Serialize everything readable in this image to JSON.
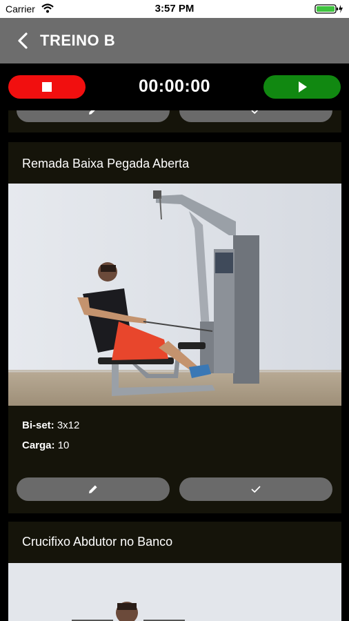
{
  "status_bar": {
    "carrier": "Carrier",
    "time": "3:57 PM"
  },
  "nav": {
    "title": "TREINO B",
    "back_icon": "chevron-left-icon"
  },
  "timer": {
    "value": "00:00:00",
    "stop_icon": "stop-icon",
    "play_icon": "play-icon"
  },
  "exercises": [
    {
      "title": "Remada Baixa Pegada Aberta",
      "set_label": "Bi-set:",
      "set_value": "3x12",
      "load_label": "Carga:",
      "load_value": "10",
      "edit_icon": "pencil-icon",
      "done_icon": "check-icon"
    },
    {
      "title": "Crucifixo Abdutor no Banco"
    }
  ],
  "colors": {
    "stop": "#f10f0f",
    "play": "#118811",
    "nav": "#6d6d6d",
    "card": "#15140a"
  }
}
